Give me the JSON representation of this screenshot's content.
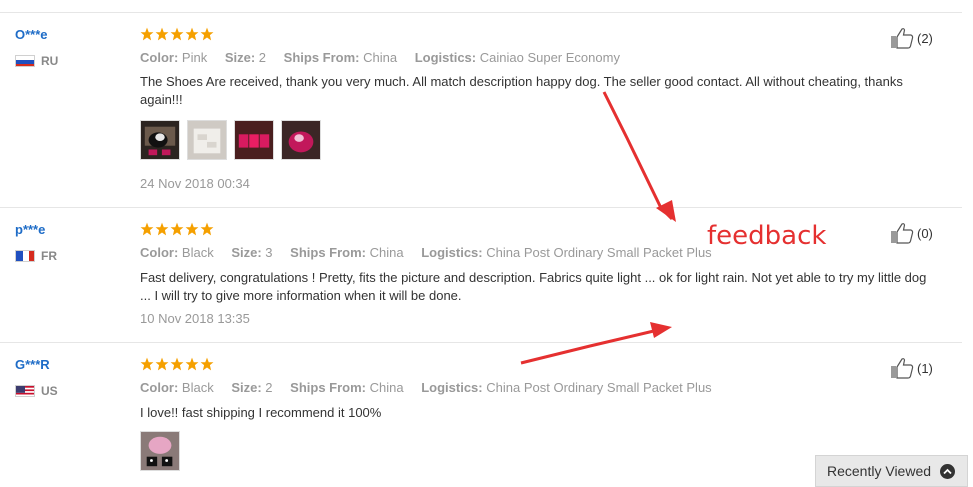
{
  "reviews": [
    {
      "user": "O***e",
      "country": "RU",
      "rating": 5,
      "labels": {
        "color": "Color:",
        "size": "Size:",
        "ships": "Ships From:",
        "logistics": "Logistics:"
      },
      "color": "Pink",
      "size": "2",
      "ships_from": "China",
      "logistics": "Cainiao Super Economy",
      "text": "The Shoes Are received, thank you very much. All match description happy dog. The seller good contact. All without cheating, thanks again!!!",
      "date": "24 Nov 2018 00:34",
      "helpful_count": "(2)"
    },
    {
      "user": "p***e",
      "country": "FR",
      "rating": 5,
      "labels": {
        "color": "Color:",
        "size": "Size:",
        "ships": "Ships From:",
        "logistics": "Logistics:"
      },
      "color": "Black",
      "size": "3",
      "ships_from": "China",
      "logistics": "China Post Ordinary Small Packet Plus",
      "text": "Fast delivery, congratulations ! Pretty, fits the picture and description. Fabrics quite light ... ok for light rain. Not yet able to try my little dog ... I will try to give more information when it will be done.",
      "date": "10 Nov 2018 13:35",
      "helpful_count": "(0)"
    },
    {
      "user": "G***R",
      "country": "US",
      "rating": 5,
      "labels": {
        "color": "Color:",
        "size": "Size:",
        "ships": "Ships From:",
        "logistics": "Logistics:"
      },
      "color": "Black",
      "size": "2",
      "ships_from": "China",
      "logistics": "China Post Ordinary Small Packet Plus",
      "text": "I love!! fast shipping I recommend it 100%",
      "helpful_count": "(1)"
    }
  ],
  "annotation": {
    "label": "feedback",
    "color": "#e53030"
  },
  "recently_viewed": {
    "label": "Recently Viewed"
  },
  "colors": {
    "username": "#1e6cc7",
    "star": "#f5a000",
    "muted": "#999999"
  }
}
